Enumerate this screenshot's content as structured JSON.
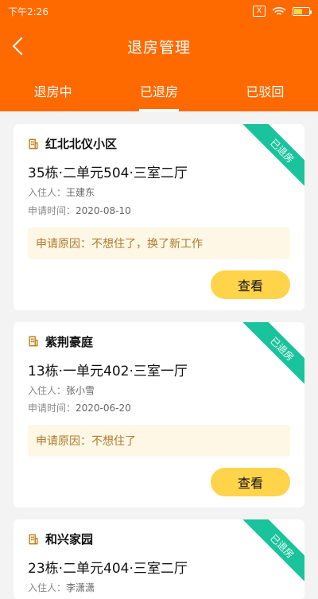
{
  "status_bar": {
    "time": "下午2:26",
    "sbox": "X"
  },
  "header": {
    "title": "退房管理"
  },
  "tabs": [
    {
      "label": "退房中",
      "active": false
    },
    {
      "label": "已退房",
      "active": true
    },
    {
      "label": "已驳回",
      "active": false
    }
  ],
  "cards": [
    {
      "complex": "红北北仪小区",
      "room": "35栋·二单元504·三室二厅",
      "occupant_label": "入住人：",
      "occupant": "王建东",
      "apply_label": "申请时间：",
      "apply_time": "2020-08-10",
      "reason_label": "申请原因：",
      "reason": "不想住了，换了新工作",
      "badge": "已退房",
      "button": "查看"
    },
    {
      "complex": "紫荆豪庭",
      "room": "13栋·一单元402·三室一厅",
      "occupant_label": "入住人：",
      "occupant": "张小雪",
      "apply_label": "申请时间：",
      "apply_time": "2020-06-20",
      "reason_label": "申请原因：",
      "reason": "不想住了",
      "badge": "已退房",
      "button": "查看"
    },
    {
      "complex": "和兴家园",
      "room": "23栋·二单元404·三室二厅",
      "occupant_label": "入住人：",
      "occupant": "李潇潇",
      "apply_label": "",
      "apply_time": "",
      "reason_label": "",
      "reason": "",
      "badge": "已退房",
      "button": ""
    }
  ],
  "colors": {
    "primary": "#ff6a00",
    "accent": "#ffd34a",
    "badge": "#19c39b",
    "reason_bg": "#fff7e6",
    "reason_text": "#b07b2d"
  },
  "icons": {
    "back": "chevron-left-icon",
    "building": "building-icon",
    "wifi": "wifi-icon",
    "battery": "battery-icon"
  }
}
